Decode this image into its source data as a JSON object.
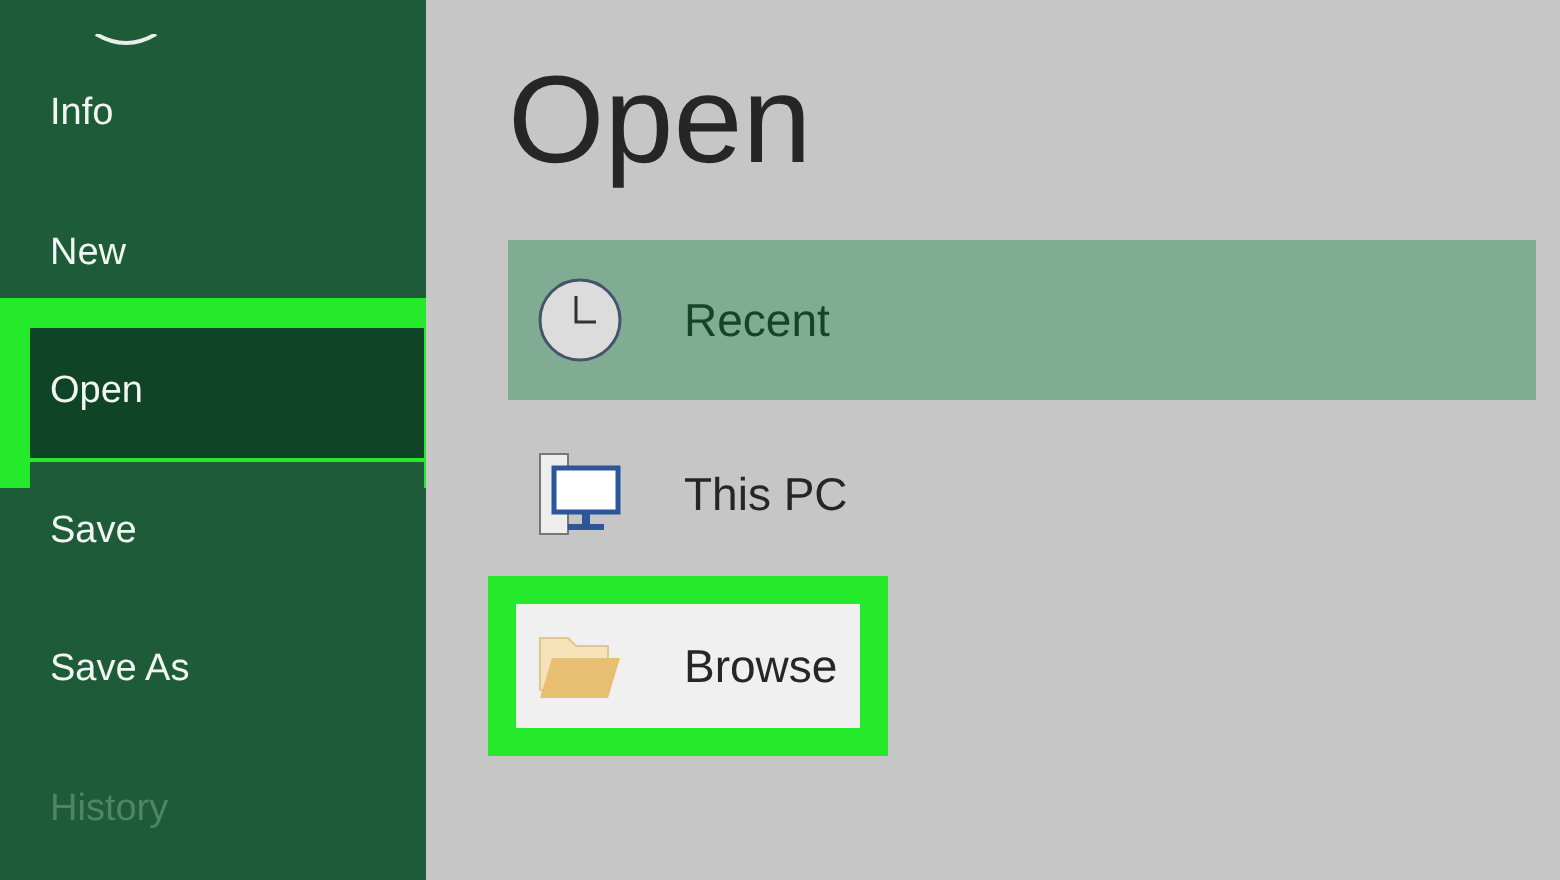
{
  "sidebar": {
    "items": [
      {
        "label": "Info",
        "selected": false,
        "highlighted": false,
        "disabled": false
      },
      {
        "label": "New",
        "selected": false,
        "highlighted": false,
        "disabled": false
      },
      {
        "label": "Open",
        "selected": true,
        "highlighted": true,
        "disabled": false
      },
      {
        "label": "Save",
        "selected": false,
        "highlighted": false,
        "disabled": false
      },
      {
        "label": "Save As",
        "selected": false,
        "highlighted": false,
        "disabled": false
      },
      {
        "label": "History",
        "selected": false,
        "highlighted": false,
        "disabled": true
      }
    ]
  },
  "page_title": "Open",
  "locations": [
    {
      "kind": "clock",
      "label": "Recent",
      "selected": true,
      "highlighted": false
    },
    {
      "kind": "pc",
      "label": "This PC",
      "selected": false,
      "highlighted": false
    },
    {
      "kind": "folder",
      "label": "Browse",
      "selected": false,
      "highlighted": true
    }
  ]
}
